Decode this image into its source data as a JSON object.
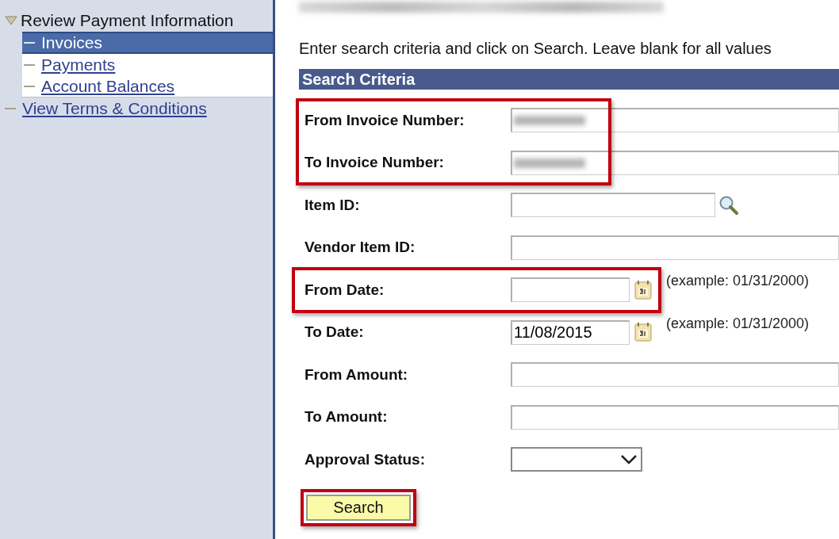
{
  "sidebar": {
    "items": [
      {
        "label": "Review Payment Information",
        "kind": "group",
        "expanded": true,
        "children": [
          {
            "label": "Invoices",
            "selected": true
          },
          {
            "label": "Payments",
            "selected": false
          },
          {
            "label": "Account Balances",
            "selected": false
          }
        ]
      },
      {
        "label": "View Terms & Conditions",
        "kind": "link"
      }
    ]
  },
  "main": {
    "intro": "Enter search criteria and click on Search. Leave blank for all values",
    "section_title": "Search Criteria",
    "rows": [
      {
        "label": "From Invoice Number:",
        "kind": "redacted",
        "highlighted": true
      },
      {
        "label": "To Invoice Number:",
        "kind": "redacted",
        "highlighted": true
      },
      {
        "label": "Item ID:",
        "kind": "lookup",
        "highlighted": false
      },
      {
        "label": "Vendor Item ID:",
        "kind": "text",
        "highlighted": false
      },
      {
        "label": "From Date:",
        "kind": "date",
        "example": "(example: 01/31/2000)",
        "highlighted": true
      },
      {
        "label": "To Date:",
        "kind": "date",
        "value": "11/08/2015",
        "example": "(example: 01/31/2000)",
        "highlighted": false
      },
      {
        "label": "From Amount:",
        "kind": "text",
        "highlighted": false
      },
      {
        "label": "To Amount:",
        "kind": "text",
        "highlighted": false
      },
      {
        "label": "Approval Status:",
        "kind": "select",
        "highlighted": false
      }
    ],
    "search_button": {
      "label": "Search",
      "highlighted": true
    }
  }
}
